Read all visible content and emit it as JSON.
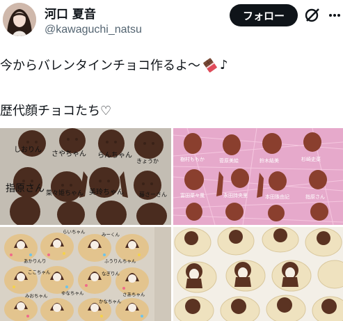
{
  "user": {
    "display_name": "河口 夏音",
    "handle": "@kawaguchi_natsu"
  },
  "header": {
    "follow_label": "フォロー"
  },
  "tweet": {
    "line1": "今からバレンタインチョコ作るよ〜",
    "line1_note": "♪",
    "line2": "歴代顔チョコたち♡"
  },
  "photos": {
    "photo1": {
      "labels": [
        "しおりん",
        "さやちゃん",
        "らんちゃん",
        "きょうか",
        "指原さん",
        "菜々姫ちゃん",
        "美玲ちゃん",
        "藤さーさん"
      ]
    },
    "photo2": {
      "labels": [
        "樹村ももか",
        "菅原美絵",
        "鈴木結美",
        "杉崎史菜",
        "富田菜々風",
        "永田詩央里",
        "本田珠由記",
        "指原さん"
      ]
    },
    "photo3": {
      "labels": [
        "らいちゃん",
        "みーくん",
        "あかりんり",
        "ふうりんちゃん",
        "ここちゃん",
        "なぎりん",
        "ゆなちゃん",
        "さあちゃん",
        "みおちゃん",
        "かなちゃん"
      ]
    }
  },
  "colors": {
    "follow_bg": "#0f1419",
    "handle": "#536471",
    "chocolate": "#4a2c1f",
    "pink_strands": "#f0a8cf"
  }
}
